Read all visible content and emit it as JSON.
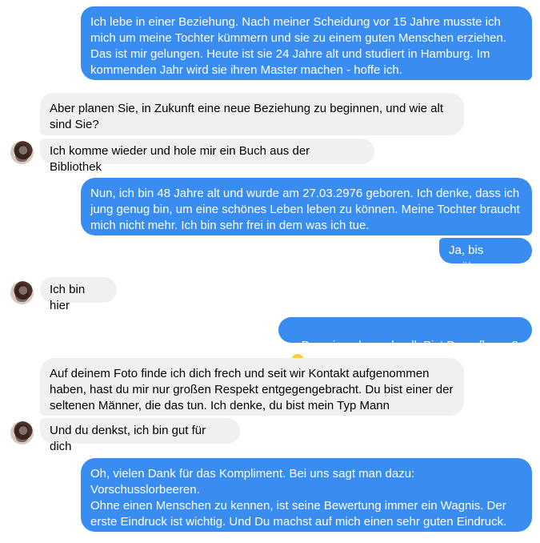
{
  "messages": [
    {
      "text": "Ich lebe in einer Beziehung. Nach meiner Scheidung vor 15 Jahre musste ich\nmich um meine Tochter kümmern und sie zu einem guten Menschen erziehen.\nDas ist mir gelungen. Heute ist sie 24 Jahre alt und studiert in Hamburg. Im\nkommenden Jahr wird sie ihren Master machen - hoffe ich."
    },
    {
      "text": "Aber planen Sie, in Zukunft eine neue Beziehung zu beginnen, und wie alt\nsind Sie?"
    },
    {
      "text": "Ich komme wieder und hole mir ein Buch aus der Bibliothek"
    },
    {
      "text": "Nun, ich bin 48 Jahre alt und wurde am 27.03.2976 geboren. Ich denke, dass ich\njung genug bin, um eine schönes Leben leben zu können. Meine Tochter braucht\nmich nicht mehr. Ich bin sehr frei in dem was ich tue."
    },
    {
      "text": "Ja, bis später."
    },
    {
      "text": "Ich bin hier"
    },
    {
      "text": "Das ging aber schnell. Bist Du geflogen?"
    },
    {
      "text": "Auf deinem Foto finde ich dich frech und seit wir Kontakt aufgenommen\nhaben, hast du mir nur großen Respekt entgegengebracht. Du bist einer der\nseltenen Männer, die das tun. Ich denke, du bist mein Typ Mann"
    },
    {
      "text": "Und du denkst, ich bin gut für dich"
    },
    {
      "text": "Oh, vielen Dank für das Kompliment. Bei uns sagt man dazu:\nVorschusslorbeeren.\nOhne einen Menschen zu kennen, ist seine Bewertung immer ein Wagnis. Der\nerste Eindruck ist wichtig. Und Du machst auf mich einen sehr guten Eindruck."
    }
  ],
  "icons": {
    "avatar": "contact-avatar",
    "emoji": "grinning-face-emoji"
  },
  "colors": {
    "outgoing": "#3a8df0",
    "incoming": "#f0f0f0"
  }
}
